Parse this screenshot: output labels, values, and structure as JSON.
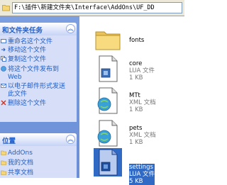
{
  "address": {
    "path": "F:\\插件\\新建文件夹\\Interface\\AddOns\\UF_DD"
  },
  "tasks_panel": {
    "title": "和文件夹任务",
    "items": [
      {
        "label": "重命名这个文件"
      },
      {
        "label": "移动这个文件"
      },
      {
        "label": "复制这个文件"
      },
      {
        "label": "将这个文件发布到",
        "label2": "Web"
      },
      {
        "label": "以电子邮件形式发送",
        "label2": "此文件"
      },
      {
        "label": "删除这个文件"
      }
    ]
  },
  "places_panel": {
    "title": "位置",
    "items": [
      {
        "label": "AddOns"
      },
      {
        "label": "我的文档"
      },
      {
        "label": "共享文档"
      }
    ]
  },
  "files": [
    {
      "name": "fonts",
      "type": "",
      "size": "",
      "icon": "folder-icon",
      "selected": false
    },
    {
      "name": "core",
      "type": "LUA 文件",
      "size": "1 KB",
      "icon": "lua-file-icon",
      "selected": false
    },
    {
      "name": "MTt",
      "type": "XML 文档",
      "size": "1 KB",
      "icon": "xml-file-icon",
      "selected": false
    },
    {
      "name": "pets",
      "type": "XML 文档",
      "size": "1 KB",
      "icon": "xml-file-icon",
      "selected": false
    },
    {
      "name": "settings",
      "type": "LUA 文件",
      "size": "5 KB",
      "icon": "lua-file-icon",
      "selected": true
    }
  ],
  "colors": {
    "task_blue": "#215dc6",
    "panel_bg": "#d6dff7",
    "sidebar_bg": "#7b9fe0",
    "selection": "#316ac5"
  }
}
